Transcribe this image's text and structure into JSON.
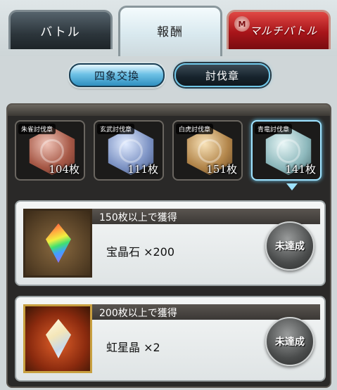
{
  "tabs": {
    "battle": "バトル",
    "reward": "報酬",
    "multi": "マルチバトル",
    "multi_emblem": "M"
  },
  "subtabs": {
    "shisho": "四象交換",
    "touba": "討伐章"
  },
  "emblems": [
    {
      "label": "朱雀討伐章",
      "count": "104枚",
      "icon": "suzaku-emblem",
      "selected": false
    },
    {
      "label": "玄武討伐章",
      "count": "111枚",
      "icon": "genbu-emblem",
      "selected": false
    },
    {
      "label": "白虎討伐章",
      "count": "151枚",
      "icon": "byakko-emblem",
      "selected": false
    },
    {
      "label": "青竜討伐章",
      "count": "141枚",
      "icon": "seiryu-emblem",
      "selected": true
    }
  ],
  "rewards": [
    {
      "condition": "150枚以上で獲得",
      "item": "宝晶石 ×200",
      "status": "未達成",
      "icon": "rainbow-crystal"
    },
    {
      "condition": "200枚以上で獲得",
      "item": "虹星晶 ×2",
      "status": "未達成",
      "icon": "rainbow-prism"
    }
  ],
  "colors": {
    "multi_tab": "#a8151a",
    "selected_glow": "#9fe3ff"
  }
}
